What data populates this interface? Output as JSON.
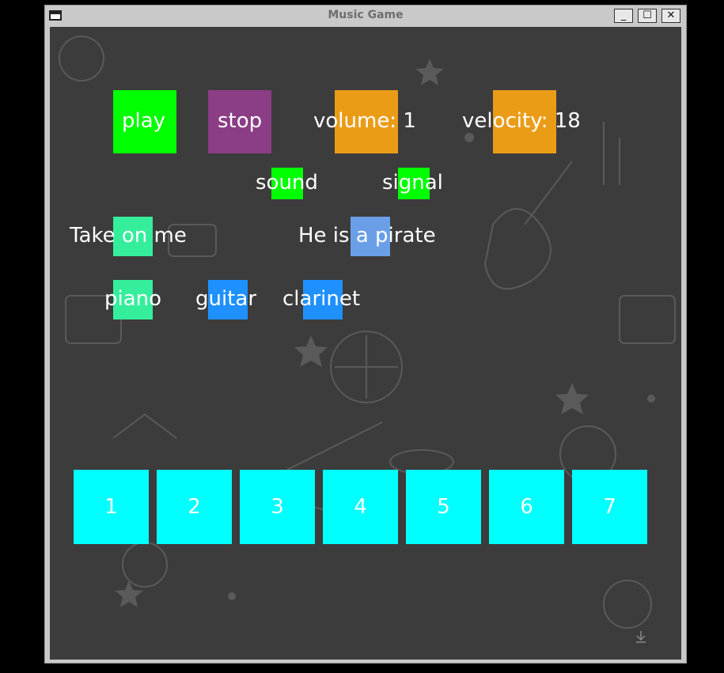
{
  "window": {
    "title": "Music Game",
    "minimize": "_",
    "maximize": "☐",
    "close": "✕"
  },
  "controls": {
    "play": "play",
    "stop": "stop",
    "volume": "volume: 1",
    "velocity": "velocity: 18"
  },
  "modes": {
    "sound": "sound",
    "signal": "signal"
  },
  "songs": [
    "Take on me",
    "He is a pirate"
  ],
  "instruments": [
    "piano",
    "guitar",
    "clarinet"
  ],
  "keys": [
    "1",
    "2",
    "3",
    "4",
    "5",
    "6",
    "7"
  ],
  "colors": {
    "green": "#00ff00",
    "purple": "#8b3d86",
    "orange": "#eb9c17",
    "teal": "#35ee9c",
    "light_blue": "#6a9fe8",
    "blue": "#1e90ff",
    "cyan": "#00ffff"
  },
  "icons": {
    "download": "download-icon"
  }
}
